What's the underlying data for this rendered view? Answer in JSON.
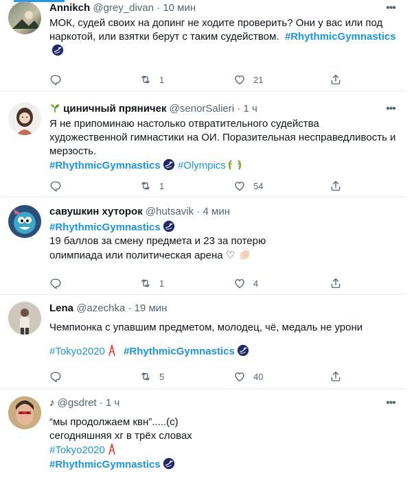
{
  "tweets": [
    {
      "name": "Annikch",
      "handle": "@grey_divan",
      "time": "10 мин",
      "text": "МОК, судей своих на допинг не ходите проверить? Они у вас или под наркотой, или взятки берут с таким судейством.",
      "tag1": "#RhythmicGymnastics",
      "replies": "",
      "retweets": "1",
      "likes": "21"
    },
    {
      "name": "циничный пряничек",
      "handle": "@senorSalieri",
      "time": "1 ч",
      "text": "Я не припоминаю настолько отвратительного судейства художественной гимнастики на ОИ. Поразительная несправедливость и мерзость.",
      "tag1": "#RhythmicGymnastics",
      "tag2": "#Olympics",
      "replies": "",
      "retweets": "1",
      "likes": "54"
    },
    {
      "name": "савушкин хуторок",
      "handle": "@hutsavik",
      "time": "4 мин",
      "tag1": "#RhythmicGymnastics",
      "line1": "19 баллов за смену предмета и 23 за потерю",
      "line2": "олимпиада или политическая арена ♡",
      "replies": "",
      "retweets": "1",
      "likes": "4"
    },
    {
      "name": "Lena",
      "handle": "@azechka",
      "time": "19 мин",
      "text": "Чемпионка с упавшим предметом, молодец, чё, медаль не урони",
      "tag1": "#Tokyo2020",
      "tag2": "#RhythmicGymnastics",
      "replies": "",
      "retweets": "5",
      "likes": "40"
    },
    {
      "name": "♪",
      "handle": "@gsdret",
      "time": "1 ч",
      "line1": "“мы продолжаем квн”.....(с)",
      "line2": "сегодняшняя хг в трёх словах",
      "tag1": "#Tokyo2020",
      "tag2": "#RhythmicGymnastics"
    }
  ],
  "sep": " · ",
  "icons": [
    "reply-icon",
    "retweet-icon",
    "like-icon",
    "share-icon",
    "more-icon",
    "gymnastics-hashflag-icon",
    "olympic-wreath-icon",
    "tokyo-tower-icon",
    "sprout-icon",
    "clapping-hands-icon"
  ],
  "colors": {
    "link": "#1b95e0",
    "secondary": "#536471",
    "divider": "#e6ecf0",
    "accent": "#1d9bf0"
  }
}
